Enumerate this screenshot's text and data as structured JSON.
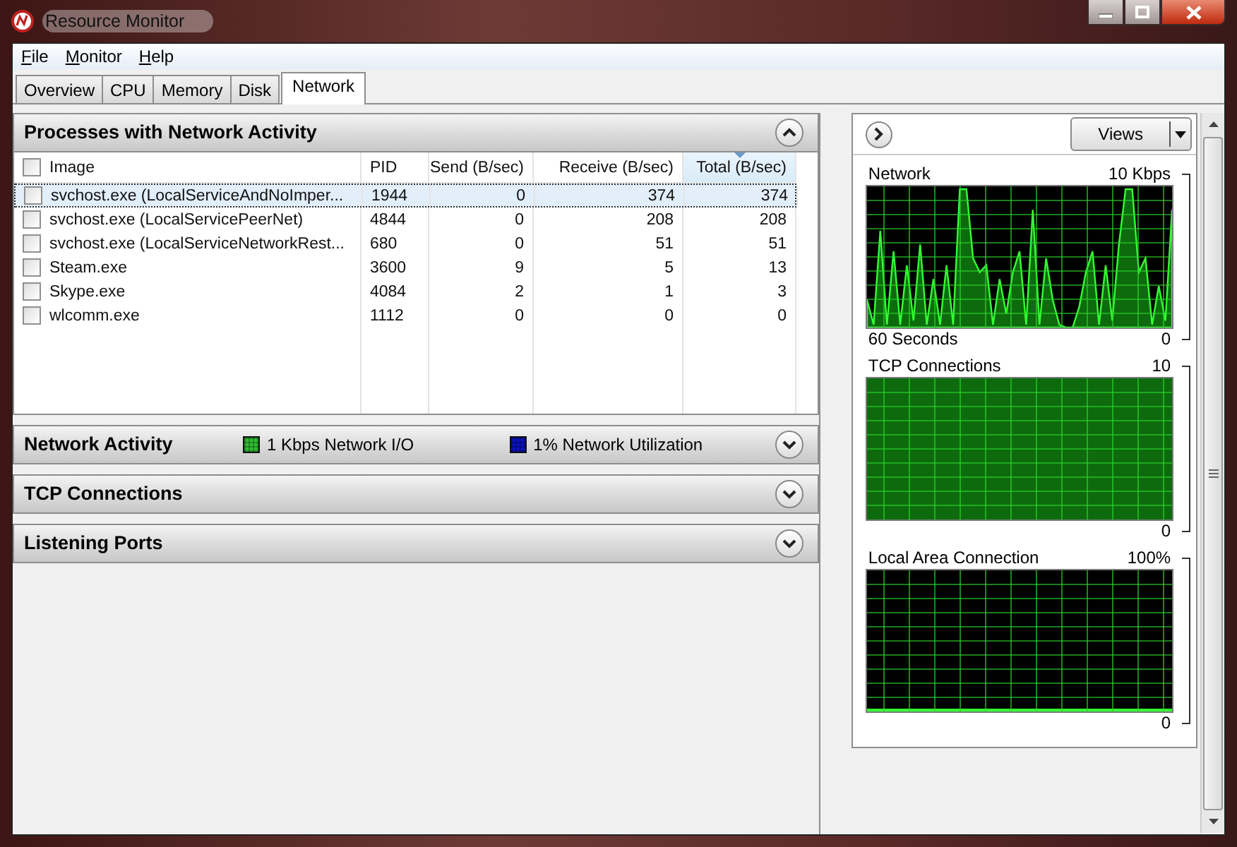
{
  "window": {
    "title": "Resource Monitor"
  },
  "menu": [
    "File",
    "Monitor",
    "Help"
  ],
  "tabs": [
    {
      "label": "Overview",
      "selected": false
    },
    {
      "label": "CPU",
      "selected": false
    },
    {
      "label": "Memory",
      "selected": false
    },
    {
      "label": "Disk",
      "selected": false
    },
    {
      "label": "Network",
      "selected": true
    }
  ],
  "sections": [
    {
      "title": "Processes with Network Activity",
      "expanded": true,
      "table": {
        "all_checked": false,
        "columns": [
          {
            "label": "Image",
            "sorted": false
          },
          {
            "label": "PID",
            "sorted": false
          },
          {
            "label": "Send (B/sec)",
            "sorted": false
          },
          {
            "label": "Receive (B/sec)",
            "sorted": false
          },
          {
            "label": "Total (B/sec)",
            "sorted": true
          }
        ],
        "rows": [
          {
            "image": "svchost.exe (LocalServiceAndNoImper...",
            "pid": "1944",
            "send": "0",
            "receive": "374",
            "total": "374",
            "checked": false,
            "selected": true
          },
          {
            "image": "svchost.exe (LocalServicePeerNet)",
            "pid": "4844",
            "send": "0",
            "receive": "208",
            "total": "208",
            "checked": false,
            "selected": false
          },
          {
            "image": "svchost.exe (LocalServiceNetworkRest...",
            "pid": "680",
            "send": "0",
            "receive": "51",
            "total": "51",
            "checked": false,
            "selected": false
          },
          {
            "image": "Steam.exe",
            "pid": "3600",
            "send": "9",
            "receive": "5",
            "total": "13",
            "checked": false,
            "selected": false
          },
          {
            "image": "Skype.exe",
            "pid": "4084",
            "send": "2",
            "receive": "1",
            "total": "3",
            "checked": false,
            "selected": false
          },
          {
            "image": "wlcomm.exe",
            "pid": "1112",
            "send": "0",
            "receive": "0",
            "total": "0",
            "checked": false,
            "selected": false
          }
        ]
      }
    },
    {
      "title": "Network Activity",
      "expanded": false,
      "legend": [
        {
          "label": "1 Kbps Network I/O",
          "color": "#2fbf2f"
        },
        {
          "label": "1% Network Utilization",
          "color": "#0a12c0"
        }
      ]
    },
    {
      "title": "TCP Connections",
      "expanded": false
    },
    {
      "title": "Listening Ports",
      "expanded": false
    }
  ],
  "side_panel": {
    "views_button": "Views",
    "graphs": [
      {
        "title": "Network",
        "max": "10 Kbps",
        "time": "60 Seconds",
        "min": "0",
        "kind": "wave"
      },
      {
        "title": "TCP Connections",
        "max": "10",
        "min": "0",
        "kind": "fill"
      },
      {
        "title": "Local Area Connection",
        "max": "100%",
        "min": "0",
        "kind": "flat"
      }
    ]
  }
}
